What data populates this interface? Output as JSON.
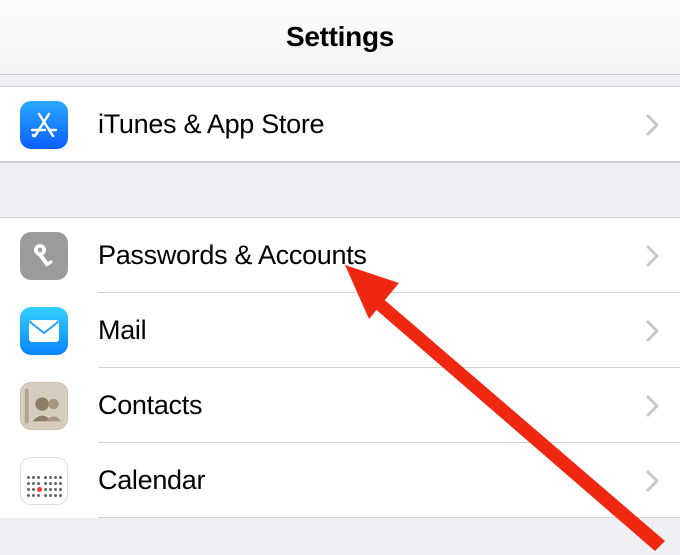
{
  "header": {
    "title": "Settings"
  },
  "sections": {
    "group1": {
      "items": [
        {
          "id": "itunes-appstore",
          "label": "iTunes & App Store",
          "icon": "appstore-icon"
        }
      ]
    },
    "group2": {
      "items": [
        {
          "id": "passwords-accounts",
          "label": "Passwords & Accounts",
          "icon": "key-icon"
        },
        {
          "id": "mail",
          "label": "Mail",
          "icon": "mail-icon"
        },
        {
          "id": "contacts",
          "label": "Contacts",
          "icon": "contacts-icon"
        },
        {
          "id": "calendar",
          "label": "Calendar",
          "icon": "calendar-icon"
        }
      ]
    }
  },
  "colors": {
    "chevron": "#c7c7cc",
    "arrow": "#f02812"
  }
}
